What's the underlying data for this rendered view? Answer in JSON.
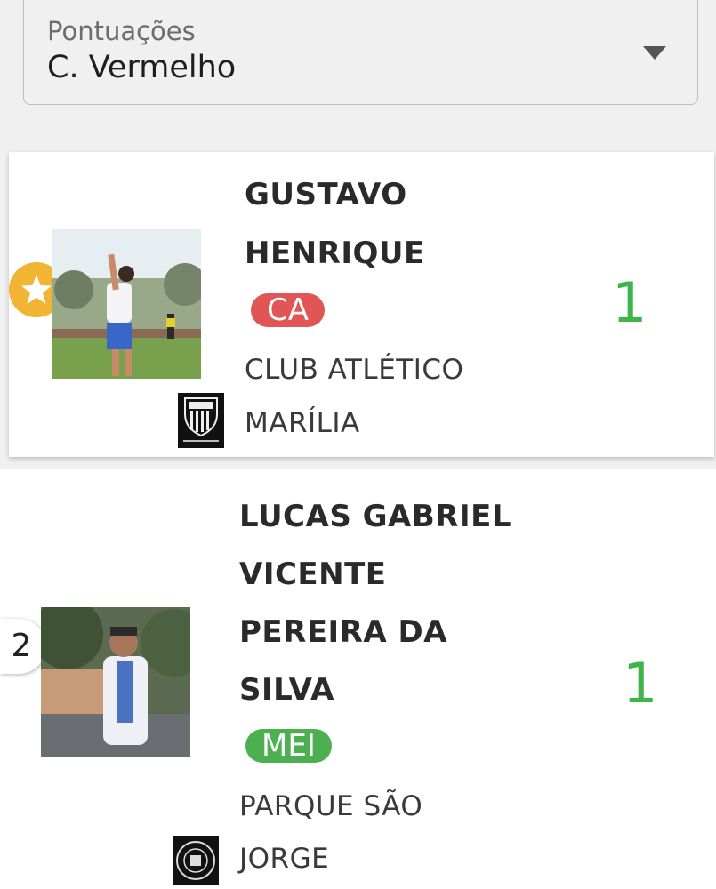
{
  "dropdown": {
    "label": "Pontuações",
    "value": "C. Vermelho"
  },
  "players": [
    {
      "rank_icon": "star-icon",
      "name_lines": [
        "GUSTAVO",
        "HENRIQUE"
      ],
      "position": "CA",
      "position_color": "#e25555",
      "club_lines": [
        "CLUB ATLÉTICO",
        "MARÍLIA"
      ],
      "club_crest_text": "Club atlético Marília",
      "score": "1"
    },
    {
      "rank": "2",
      "name_lines": [
        "LUCAS GABRIEL",
        "VICENTE",
        "PEREIRA DA",
        "SILVA"
      ],
      "position": "MEI",
      "position_color": "#4cb050",
      "club_lines": [
        "PARQUE SÃO",
        "JORGE"
      ],
      "club_crest_text": "PARQUE SÃO JORGE",
      "score": "1"
    }
  ],
  "colors": {
    "score": "#3cb54a",
    "star_badge": "#f2b533"
  }
}
